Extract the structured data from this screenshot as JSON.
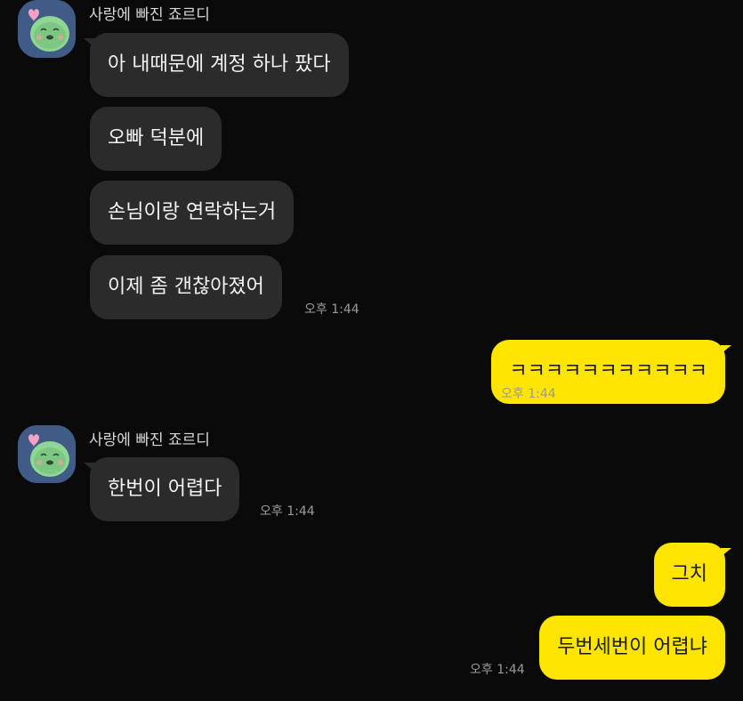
{
  "colors": {
    "background": "#0a0a0a",
    "incoming_bubble": "#2b2b2b",
    "outgoing_bubble": "#fee500",
    "avatar_bg": "#3f5b86"
  },
  "messages": {
    "group1": {
      "sender": "사랑에 빠진 죠르디",
      "avatar_icon": "jordy-avatar-icon",
      "bubbles": [
        "아 내때문에 계정 하나 팠다",
        "오빠 덕분에",
        "손님이랑 연락하는거",
        "이제 좀 갠찮아졌어"
      ],
      "time": "오후 1:44"
    },
    "group2": {
      "bubbles": [
        "ㅋㅋㅋㅋㅋㅋㅋㅋㅋㅋㅋ"
      ],
      "time": "오후 1:44"
    },
    "group3": {
      "sender": "사랑에 빠진 죠르디",
      "avatar_icon": "jordy-avatar-icon",
      "bubbles": [
        "한번이 어렵다"
      ],
      "time": "오후 1:44"
    },
    "group4": {
      "bubbles": [
        "그치",
        "두번세번이 어렵냐"
      ],
      "time": "오후 1:44"
    }
  }
}
